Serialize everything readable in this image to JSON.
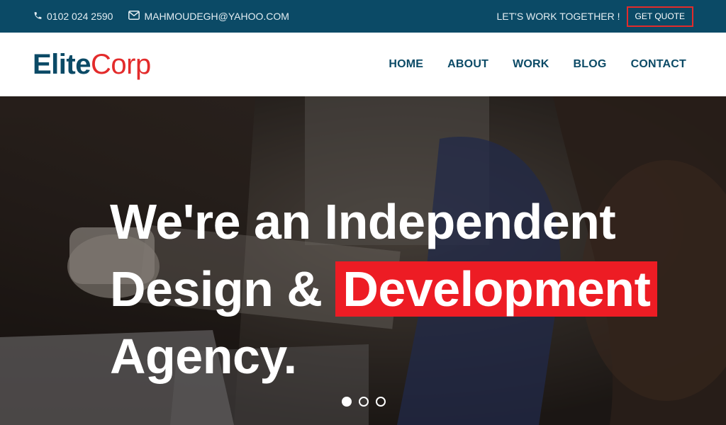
{
  "topbar": {
    "phone": "0102 024 2590",
    "email": "MAHMOUDEGH@YAHOO.COM",
    "tagline": "LET'S WORK TOGETHER !",
    "quote_label": "GET QUOTE"
  },
  "brand": {
    "part1": "Elite",
    "part2": "Corp"
  },
  "nav": {
    "items": [
      {
        "label": "HOME"
      },
      {
        "label": "ABOUT"
      },
      {
        "label": "WORK"
      },
      {
        "label": "BLOG"
      },
      {
        "label": "CONTACT"
      }
    ]
  },
  "hero": {
    "line1": "We're an Independent",
    "line2_prefix": "Design & ",
    "line2_highlight": "Development",
    "line3": "Agency."
  },
  "slider": {
    "count": 3,
    "active_index": 0
  },
  "colors": {
    "primary": "#0b4a66",
    "accent": "#ed1c24"
  },
  "icons": {
    "phone": "phone-icon",
    "email": "envelope-icon"
  }
}
